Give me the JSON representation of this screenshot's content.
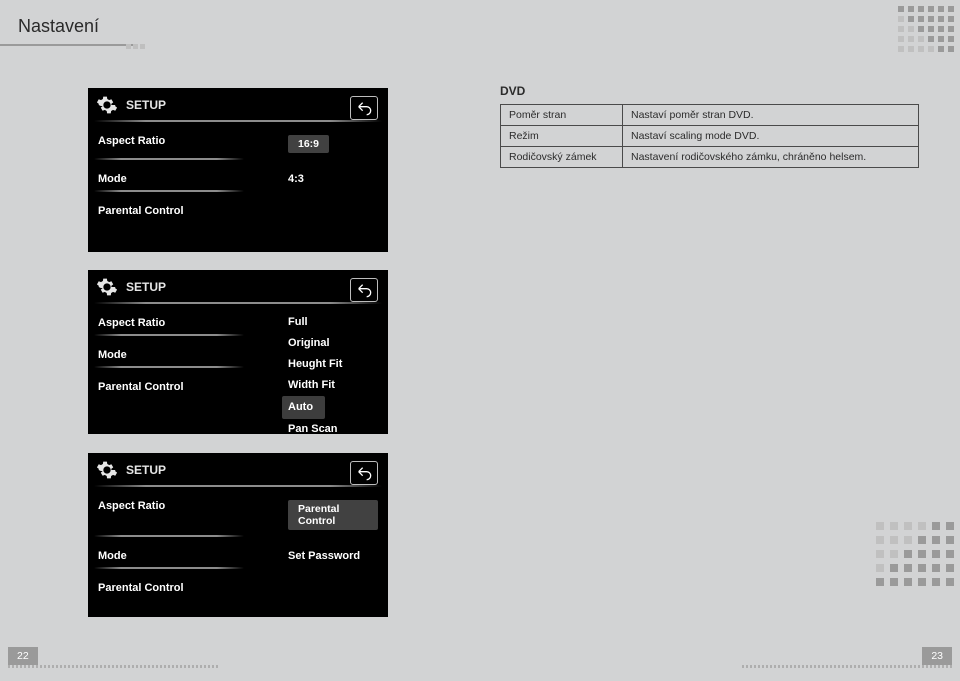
{
  "header": {
    "title": "Nastavení"
  },
  "setup_label": "SETUP",
  "panel1": {
    "items": [
      "Aspect Ratio",
      "Mode",
      "Parental Control"
    ],
    "values": [
      "16:9",
      "4:3",
      ""
    ]
  },
  "panel2": {
    "items": [
      "Aspect Ratio",
      "Mode",
      "Parental Control"
    ],
    "options": [
      "Full",
      "Original",
      "Heught Fit",
      "Width Fit",
      "Auto",
      "Pan Scan"
    ],
    "selected_option": "Auto"
  },
  "panel3": {
    "items": [
      "Aspect Ratio",
      "Mode",
      "Parental Control"
    ],
    "values": [
      "Parental Control",
      "Set Password",
      ""
    ]
  },
  "dvd": {
    "title": "DVD",
    "rows": [
      {
        "label": "Poměr stran",
        "desc": "Nastaví poměr stran DVD."
      },
      {
        "label": "Režim",
        "desc": "Nastaví scaling mode DVD."
      },
      {
        "label": "Rodičovský zámek",
        "desc": "Nastavení rodičovského zámku, chráněno helsem."
      }
    ]
  },
  "pages": {
    "left": "22",
    "right": "23"
  }
}
